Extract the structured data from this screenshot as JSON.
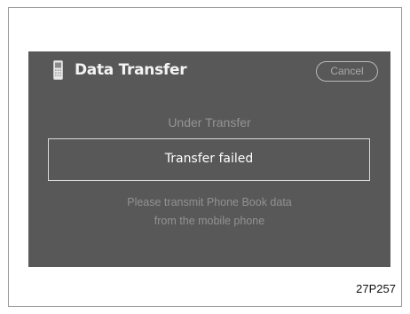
{
  "screen": {
    "title": "Data Transfer",
    "cancel_label": "Cancel",
    "status_label": "Under Transfer",
    "message": "Transfer failed",
    "instruction_line1": "Please transmit Phone Book data",
    "instruction_line2": "from the mobile phone"
  },
  "caption": "27P257",
  "icons": {
    "title_icon": "mobile-phone-icon"
  },
  "colors": {
    "screen_background": "#585858",
    "title_text": "#f4f4f4",
    "dim_text": "#949494",
    "button_border": "#b9b9b9"
  }
}
